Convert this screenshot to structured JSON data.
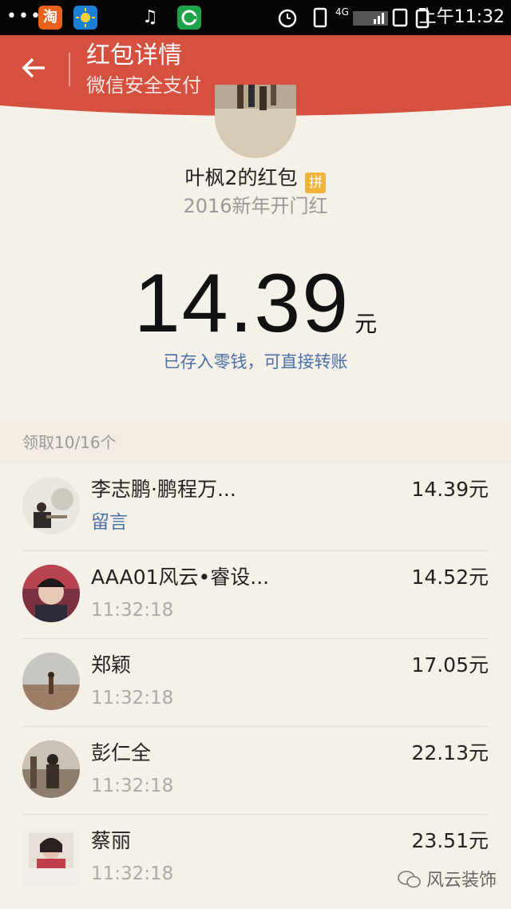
{
  "status_bar": {
    "app_taobao_label": "淘",
    "time": "上午11:32",
    "network_label": "4G",
    "colors": {
      "taobao": "#e8621c",
      "weather": "#1c7fd6",
      "wechat_like": "#1ea24a"
    }
  },
  "header": {
    "title": "红包详情",
    "subtitle": "微信安全支付",
    "color": "#d6503f"
  },
  "sender": {
    "name": "叶枫2的红包",
    "badge": "拼",
    "greeting": "2016新年开门红"
  },
  "amount": {
    "value": "14.39",
    "unit": "元",
    "note": "已存入零钱，可直接转账"
  },
  "summary": "领取10/16个",
  "recipients": [
    {
      "name": "李志鹏·鹏程万...",
      "sub": "留言",
      "amount": "14.39元",
      "sub_is_link": true
    },
    {
      "name": "AAA01风云•睿设...",
      "sub": "11:32:18",
      "amount": "14.52元"
    },
    {
      "name": "郑颖",
      "sub": "11:32:18",
      "amount": "17.05元"
    },
    {
      "name": "彭仁全",
      "sub": "11:32:18",
      "amount": "22.13元"
    },
    {
      "name": "蔡丽",
      "sub": "11:32:18",
      "amount": "23.51元"
    }
  ],
  "watermark": "风云装饰"
}
